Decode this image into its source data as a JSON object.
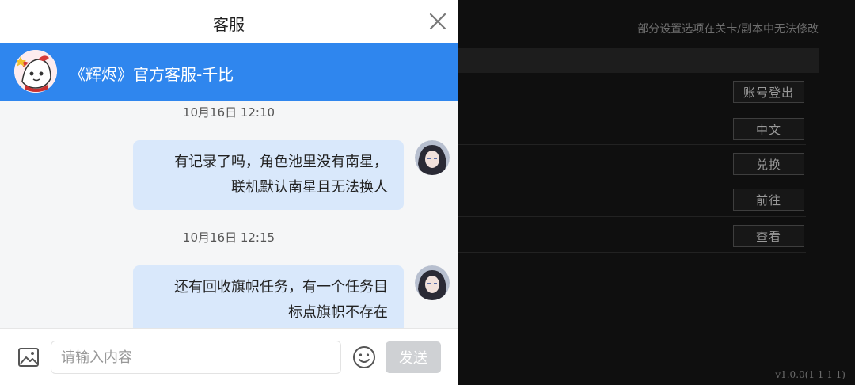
{
  "background": {
    "note": "部分设置选项在关卡/副本中无法修改",
    "buttons": [
      "账号登出",
      "中文",
      "兑换",
      "前往",
      "查看"
    ],
    "version": "v1.0.0(1 1 1 1)"
  },
  "chat": {
    "title": "客服",
    "agent_name": "《辉烬》官方客服-千比",
    "messages": [
      {
        "time": "10月16日 12:10",
        "lines": [
          "有记录了吗，角色池里没有南星，",
          "联机默认南星且无法换人"
        ]
      },
      {
        "time": "10月16日 12:15",
        "lines": [
          "还有回收旗帜任务，有一个任务目",
          "标点旗帜不存在"
        ]
      }
    ],
    "input_placeholder": "请输入内容",
    "send_label": "发送"
  },
  "colors": {
    "agent_bar": "#2f86ee",
    "bubble": "#d9e8fb",
    "send_disabled": "#cfd1d4"
  },
  "icons": [
    "close-icon",
    "image-icon",
    "emoji-icon"
  ]
}
